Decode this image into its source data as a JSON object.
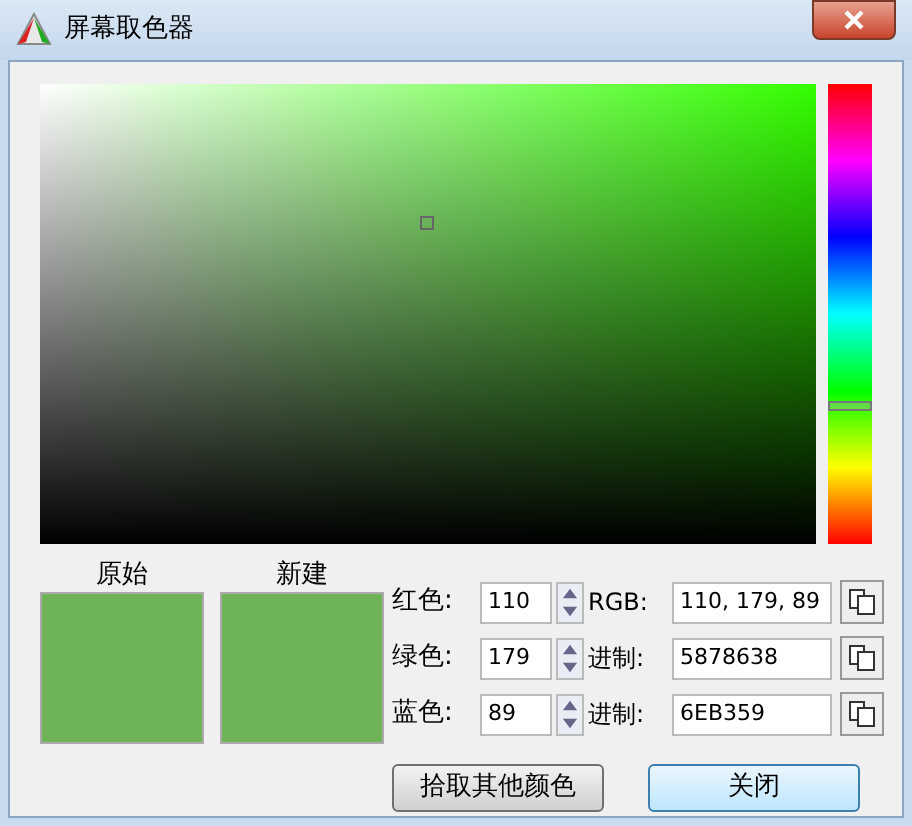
{
  "window": {
    "title": "屏幕取色器"
  },
  "picker": {
    "hue": {
      "level": 0.3
    }
  },
  "swatches": [
    {
      "label": "原始",
      "color": "#6eb359"
    },
    {
      "label": "新建",
      "color": "#6eb359"
    }
  ],
  "rows": [
    {
      "label": "红色:",
      "value": "110",
      "output_label": "RGB:",
      "output": "110, 179, 89"
    },
    {
      "label": "绿色:",
      "value": "179",
      "output_label": "进制:",
      "output": "5878638"
    },
    {
      "label": "蓝色:",
      "value": "89",
      "output_label": "进制:",
      "output": "6EB359"
    }
  ],
  "buttons": [
    {
      "label": "拾取其他颜色",
      "kind": "normal"
    },
    {
      "label": "关闭",
      "kind": "default"
    }
  ]
}
